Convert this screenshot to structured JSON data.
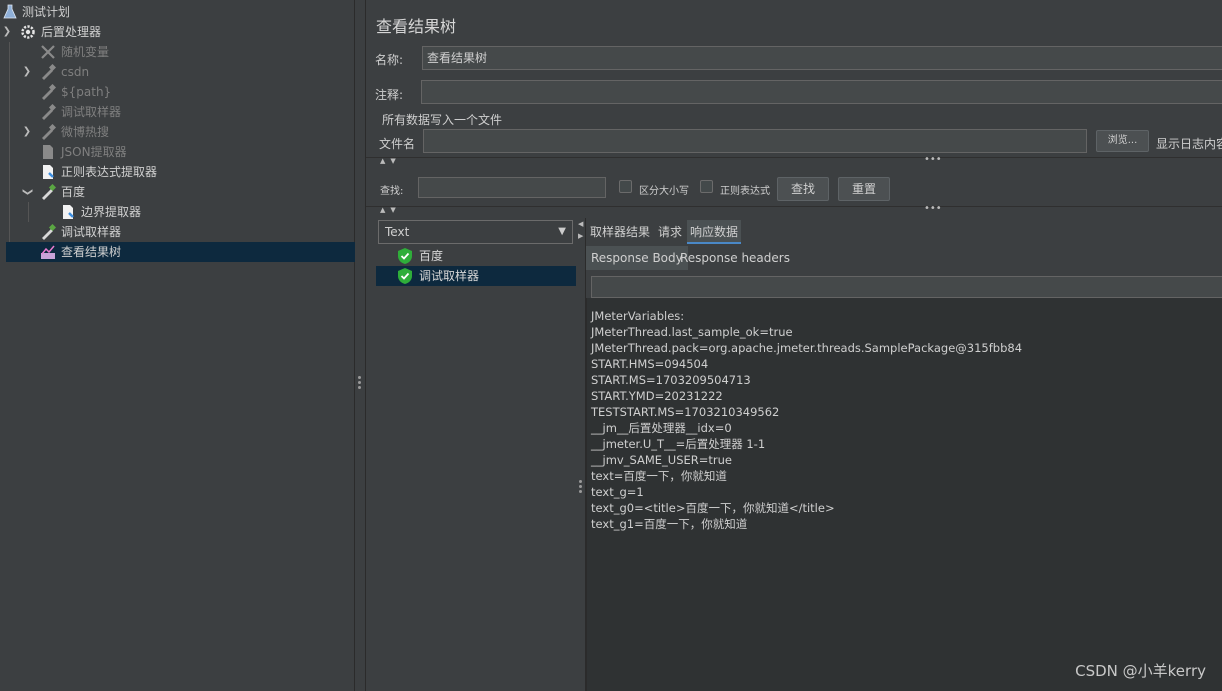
{
  "tree": {
    "items": [
      {
        "label": "测试计划",
        "icon": "flask-icon"
      },
      {
        "label": "后置处理器",
        "icon": "gear-icon"
      },
      {
        "label": "随机变量",
        "icon": "tools-icon"
      },
      {
        "label": "csdn",
        "icon": "pipette-icon"
      },
      {
        "label": "${path}",
        "icon": "pipette-icon"
      },
      {
        "label": "调试取样器",
        "icon": "pipette-icon"
      },
      {
        "label": "微博热搜",
        "icon": "pipette-icon"
      },
      {
        "label": "JSON提取器",
        "icon": "document-icon"
      },
      {
        "label": "正则表达式提取器",
        "icon": "document-icon"
      },
      {
        "label": "百度",
        "icon": "pipette-icon"
      },
      {
        "label": "边界提取器",
        "icon": "document-icon"
      },
      {
        "label": "调试取样器",
        "icon": "pipette-icon"
      },
      {
        "label": "查看结果树",
        "icon": "chart-icon"
      }
    ]
  },
  "main": {
    "title": "查看结果树",
    "name_label": "名称:",
    "name_value": "查看结果树",
    "comment_label": "注释:",
    "comment_value": "",
    "section_label": "所有数据写入一个文件",
    "filename_label": "文件名",
    "filename_value": "",
    "browse_label": "浏览...",
    "log_label": "显示日志内容",
    "search_label": "查找:",
    "case_label": "区分大小写",
    "regex_label": "正则表达式",
    "find_button": "查找",
    "reset_button": "重置"
  },
  "results": {
    "renderer": "Text",
    "items": [
      {
        "label": "百度",
        "status": "success"
      },
      {
        "label": "调试取样器",
        "status": "success"
      }
    ]
  },
  "response": {
    "tabs": [
      "取样器结果",
      "请求",
      "响应数据"
    ],
    "active_tab": "响应数据",
    "subtabs": [
      "Response Body",
      "Response headers"
    ],
    "active_subtab": "Response Body",
    "body_lines": [
      "JMeterVariables:",
      "JMeterThread.last_sample_ok=true",
      "JMeterThread.pack=org.apache.jmeter.threads.SamplePackage@315fbb84",
      "START.HMS=094504",
      "START.MS=1703209504713",
      "START.YMD=20231222",
      "TESTSTART.MS=1703210349562",
      "__jm__后置处理器__idx=0",
      "__jmeter.U_T__=后置处理器 1-1",
      "__jmv_SAME_USER=true",
      "text=百度一下，你就知道",
      "text_g=1",
      "text_g0=<title>百度一下，你就知道</title>",
      "text_g1=百度一下，你就知道"
    ]
  },
  "watermark": "CSDN @小羊kerry"
}
